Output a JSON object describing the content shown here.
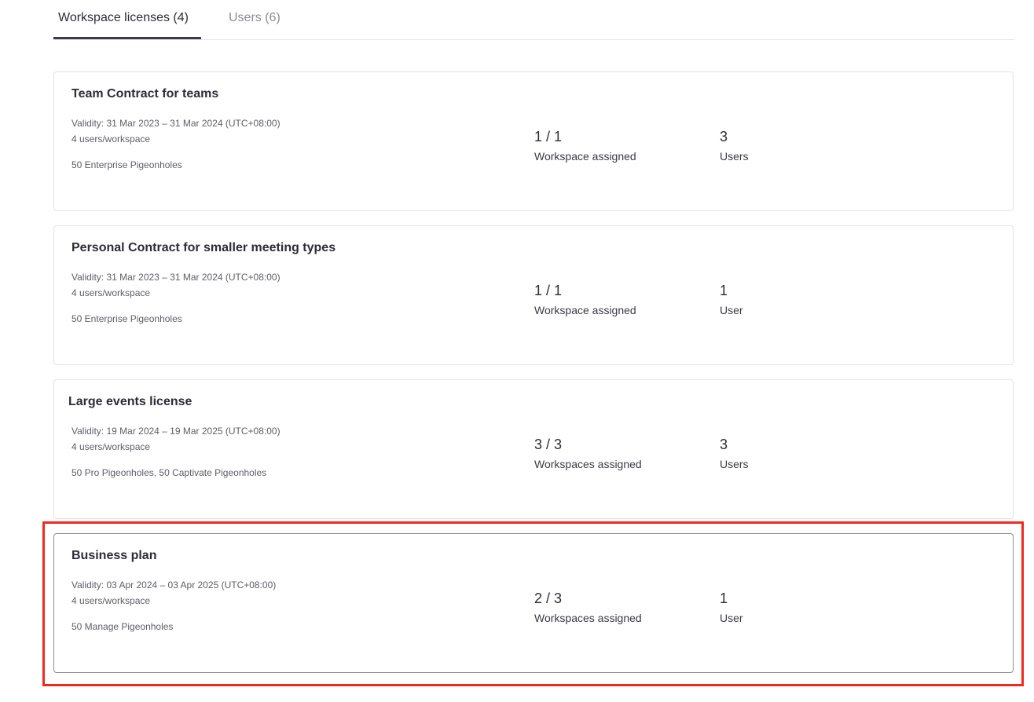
{
  "tabs": [
    {
      "label": "Workspace licenses (4)",
      "active": true
    },
    {
      "label": "Users (6)",
      "active": false
    }
  ],
  "licenses": [
    {
      "title": "Team Contract for teams",
      "validity": "Validity: 31 Mar 2023 – 31 Mar 2024 (UTC+08:00)",
      "users_per_workspace": "4 users/workspace",
      "pigeonholes": "50 Enterprise Pigeonholes",
      "workspaces_value": "1 / 1",
      "workspaces_label": "Workspace assigned",
      "users_value": "3",
      "users_label": "Users"
    },
    {
      "title": "Personal Contract for smaller meeting types",
      "validity": "Validity: 31 Mar 2023 – 31 Mar 2024 (UTC+08:00)",
      "users_per_workspace": "4 users/workspace",
      "pigeonholes": "50 Enterprise Pigeonholes",
      "workspaces_value": "1 / 1",
      "workspaces_label": "Workspace assigned",
      "users_value": "1",
      "users_label": "User"
    },
    {
      "title": "Large events license",
      "validity": "Validity: 19 Mar 2024 – 19 Mar 2025 (UTC+08:00)",
      "users_per_workspace": "4 users/workspace",
      "pigeonholes": "50 Pro Pigeonholes, 50 Captivate Pigeonholes",
      "workspaces_value": "3 / 3",
      "workspaces_label": "Workspaces assigned",
      "users_value": "3",
      "users_label": "Users"
    },
    {
      "title": "Business plan",
      "validity": "Validity: 03 Apr 2024 – 03 Apr 2025 (UTC+08:00)",
      "users_per_workspace": "4 users/workspace",
      "pigeonholes": "50 Manage Pigeonholes",
      "workspaces_value": "2 / 3",
      "workspaces_label": "Workspaces assigned",
      "users_value": "1",
      "users_label": "User"
    }
  ],
  "colors": {
    "text": "#2c2c3a",
    "muted": "#8b8b98",
    "border": "#e3e3e8",
    "highlight": "#f02a1e"
  }
}
